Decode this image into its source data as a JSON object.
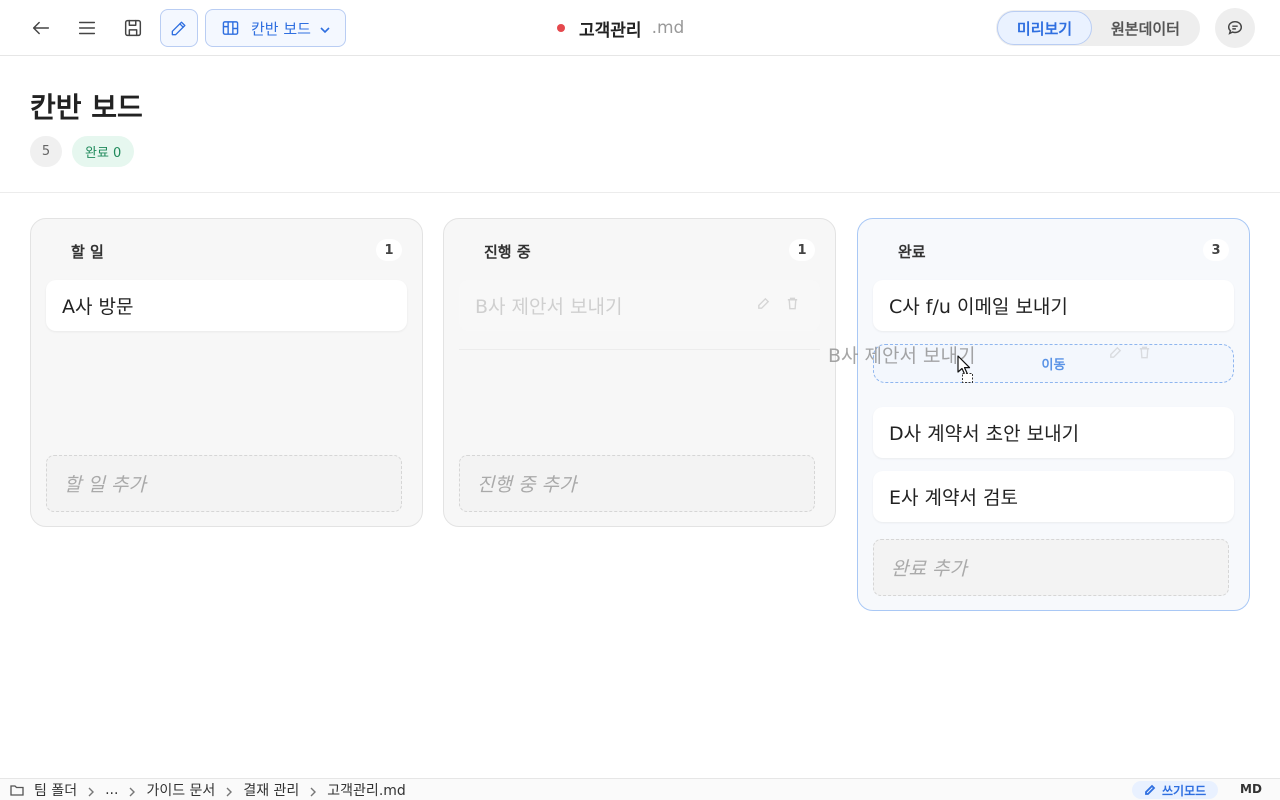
{
  "toolbar": {
    "view_label": "칸반 보드",
    "doc_name": "고객관리",
    "doc_ext": ".md",
    "unsaved_color": "#e5484d",
    "seg_preview": "미리보기",
    "seg_raw": "원본데이터"
  },
  "header": {
    "title": "칸반 보드",
    "total_count": "5",
    "done_label": "완료 0"
  },
  "columns": {
    "todo": {
      "title": "할 일",
      "count": "1",
      "cards": [
        "A사 방문"
      ],
      "add_placeholder": "할 일 추가"
    },
    "doing": {
      "title": "진행 중",
      "count": "1",
      "cards": [
        "B사 제안서 보내기"
      ],
      "add_placeholder": "진행 중 추가"
    },
    "done": {
      "title": "완료",
      "count": "3",
      "cards": [
        "C사 f/u 이메일 보내기",
        "D사 계약서 초안 보내기",
        "E사 계약서 검토"
      ],
      "add_placeholder": "완료 추가",
      "drop_label": "이동"
    }
  },
  "drag": {
    "ghost_text": "B사 제안서 보내기"
  },
  "statusbar": {
    "crumbs": [
      "팀 폴더",
      "...",
      "가이드 문서",
      "결재 관리",
      "고객관리.md"
    ],
    "mode": "쓰기모드",
    "format": "MD"
  },
  "colors": {
    "accent": "#2f6fe0",
    "done_badge": "#1f8a5b"
  }
}
